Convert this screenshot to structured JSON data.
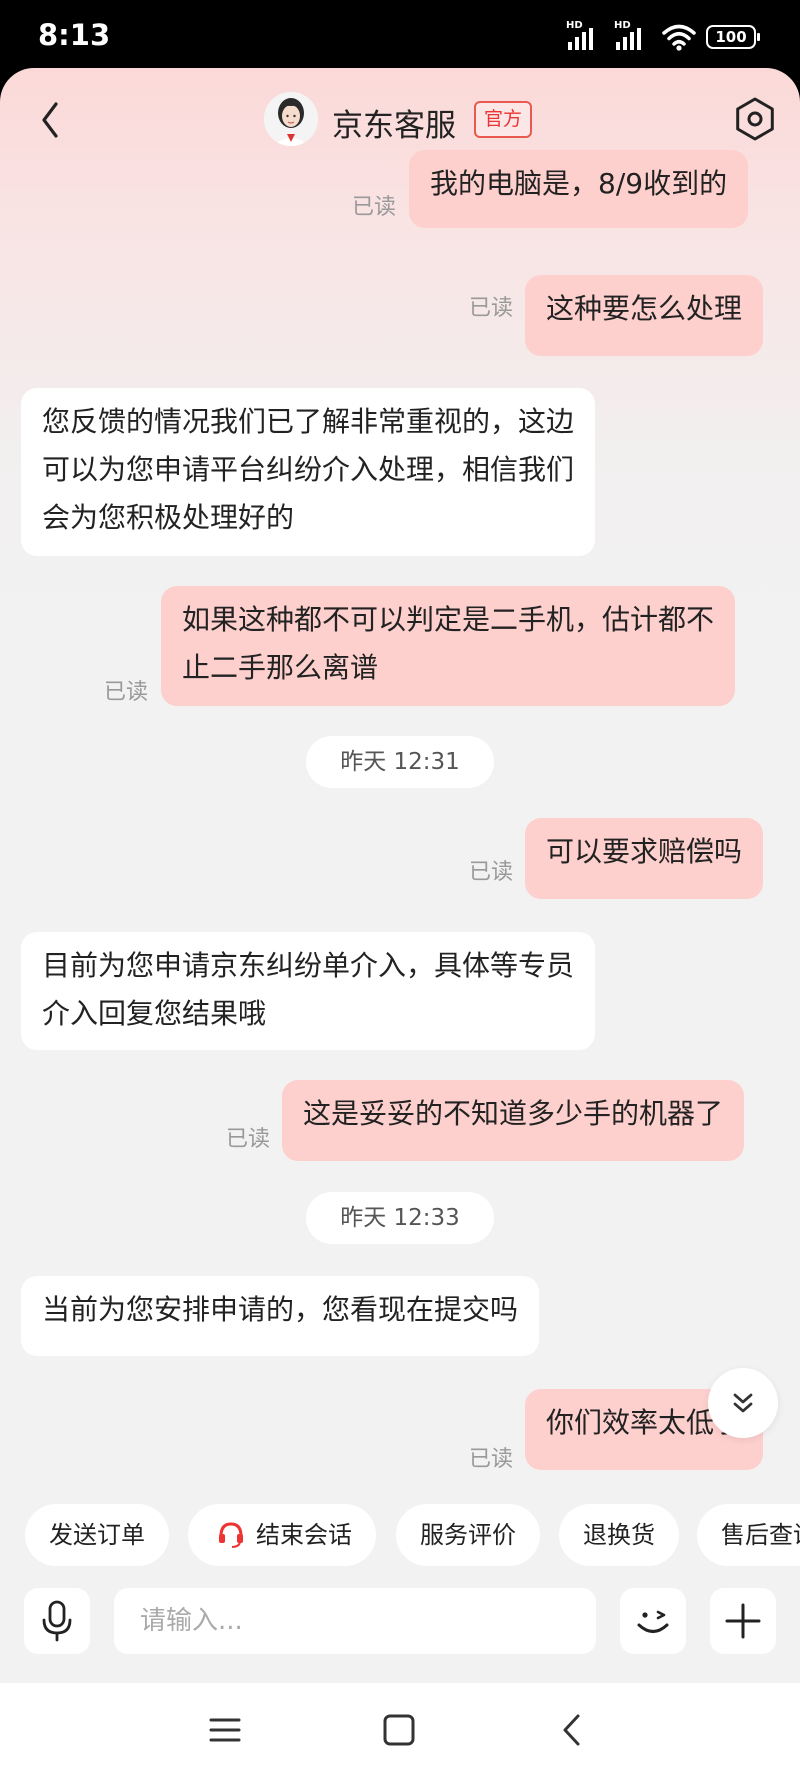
{
  "status_bar": {
    "time": "8:13",
    "battery": "100",
    "network_tags": [
      "HD",
      "HD"
    ]
  },
  "header": {
    "title": "京东客服",
    "badge": "官方"
  },
  "messages": [
    {
      "side": "user",
      "text": "我的电脑是，8/9收到的",
      "read": "已读"
    },
    {
      "side": "user",
      "text": "这种要怎么处理",
      "read": "已读"
    },
    {
      "side": "agent",
      "lines": [
        "您反馈的情况我们已了解非常重视的，这边",
        "可以为您申请平台纠纷介入处理，相信我们",
        "会为您积极处理好的"
      ]
    },
    {
      "side": "user",
      "lines": [
        "如果这种都不可以判定是二手机，估计都不",
        "止二手那么离谱"
      ],
      "read": "已读"
    },
    {
      "side": "time",
      "text": "昨天 12:31"
    },
    {
      "side": "user",
      "text": "可以要求赔偿吗",
      "read": "已读"
    },
    {
      "side": "agent",
      "lines": [
        "目前为您申请京东纠纷单介入，具体等专员",
        "介入回复您结果哦"
      ]
    },
    {
      "side": "user",
      "text": "这是妥妥的不知道多少手的机器了",
      "read": "已读"
    },
    {
      "side": "time",
      "text": "昨天 12:33"
    },
    {
      "side": "agent",
      "text": "当前为您安排申请的，您看现在提交吗"
    },
    {
      "side": "user",
      "text": "你们效率太低了",
      "read": "已读"
    }
  ],
  "quick_actions": [
    "发送订单",
    "结束会话",
    "服务评价",
    "退换货",
    "售后查询"
  ],
  "input": {
    "placeholder": "请输入..."
  },
  "colors": {
    "user_bubble": "#fdd0ce",
    "agent_bubble": "#ffffff",
    "accent": "#e33333"
  }
}
